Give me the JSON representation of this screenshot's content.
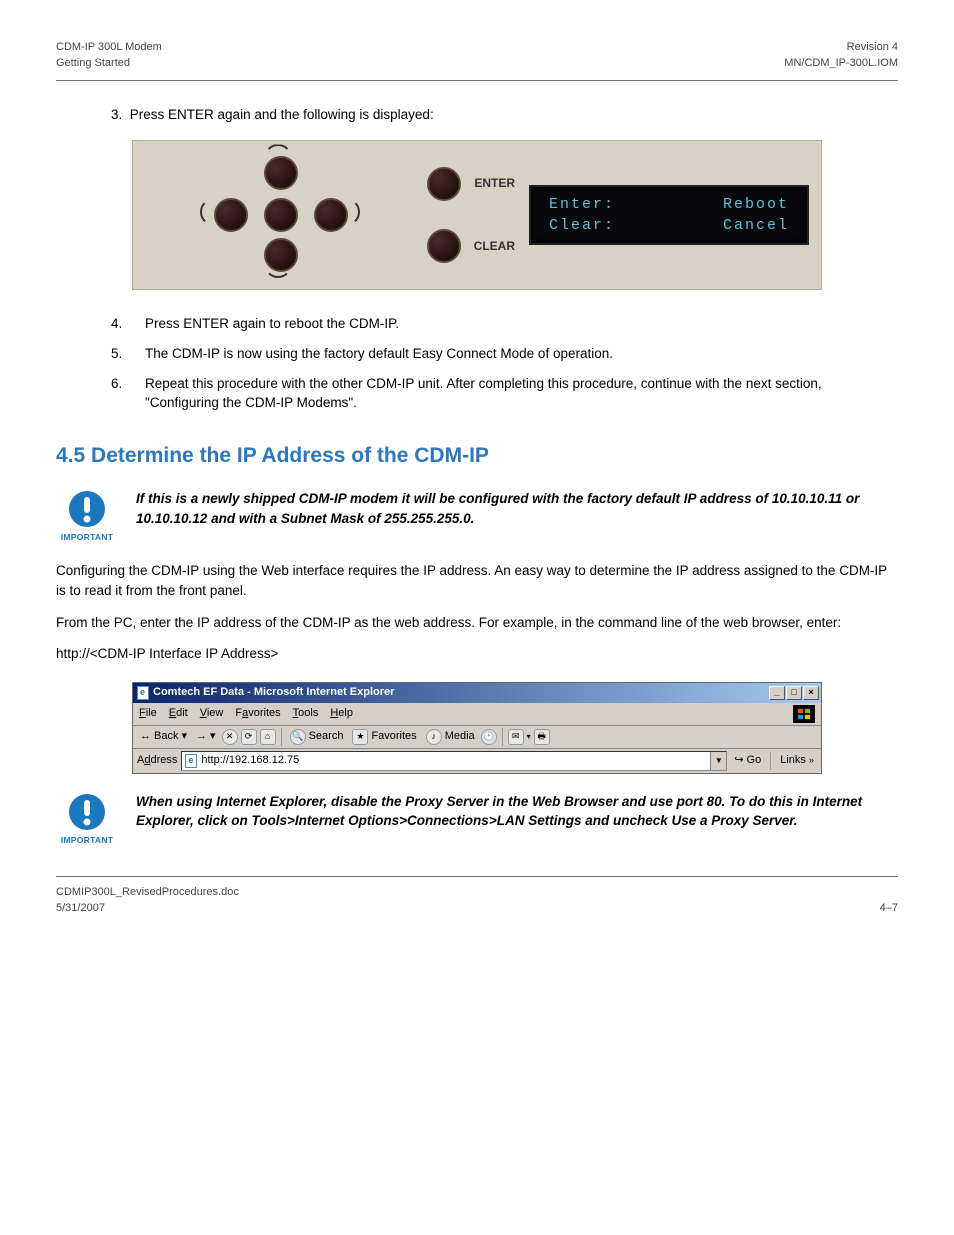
{
  "header": {
    "left_line1": "CDM-IP 300L Modem",
    "left_line2": "Getting Started",
    "right_line1": "Revision 4",
    "right_line2": "MN/CDM_IP-300L.IOM"
  },
  "intro_step": {
    "num": "3",
    "text": "Press ENTER again and the following is displayed:"
  },
  "panel": {
    "enter_label": "ENTER",
    "clear_label": "CLEAR",
    "lcd_row1_left": "Enter:",
    "lcd_row1_right": "Reboot",
    "lcd_row2_left": "Clear:",
    "lcd_row2_right": "Cancel"
  },
  "steps": [
    {
      "num": "4",
      "text": "Press ENTER again to reboot the CDM-IP."
    },
    {
      "num": "5",
      "text": "The CDM-IP is now using the factory default Easy Connect Mode of operation."
    },
    {
      "num": "6",
      "text": "Repeat this procedure with the other CDM-IP unit. After completing this procedure, continue with the next section, \"Configuring the CDM-IP Modems\"."
    }
  ],
  "section_heading": "4.5 Determine the IP Address of the CDM-IP",
  "notes": {
    "note1": "If this is a newly shipped CDM-IP modem it will be configured with the factory default IP address of 10.10.10.11 or 10.10.10.12 and with a Subnet Mask of 255.255.255.0.",
    "note2": "When using Internet Explorer, disable the Proxy Server in the Web Browser and use port 80. To do this in Internet Explorer, click on Tools>Internet Options>Connections>LAN Settings and uncheck Use a Proxy Server."
  },
  "paragraphs": {
    "p1": "Configuring the CDM-IP using the Web interface requires the IP address. An easy way to determine the IP address assigned to the CDM-IP is to read it from the front panel.",
    "p2": "From the PC, enter the IP address of the CDM-IP as the web address. For example, in the command line of the web browser, enter:",
    "addr_example": "http://<CDM-IP Interface IP Address>"
  },
  "ie": {
    "title": "Comtech EF Data - Microsoft Internet Explorer",
    "menus": [
      "File",
      "Edit",
      "View",
      "Favorites",
      "Tools",
      "Help"
    ],
    "back": "Back",
    "search": "Search",
    "favorites": "Favorites",
    "media": "Media",
    "address_label": "Address",
    "address_value": "http://192.168.12.75",
    "go": "Go",
    "links": "Links"
  },
  "footer": {
    "doc": "CDMIP300L_RevisedProcedures.doc",
    "date": "5/31/2007",
    "page": "4–7"
  }
}
